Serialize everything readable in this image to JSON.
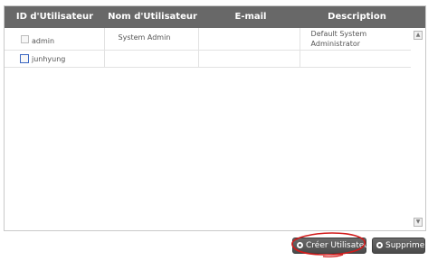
{
  "table": {
    "headers": [
      "ID d'Utilisateur",
      "Nom d'Utilisateur",
      "E-mail",
      "Description"
    ],
    "rows": [
      {
        "id": "admin",
        "name": "System Admin",
        "email": "",
        "description_line1": "Default System",
        "description_line2": "Administrator"
      },
      {
        "id": "junhyung",
        "name": "",
        "email": "",
        "description_line1": "",
        "description_line2": ""
      }
    ]
  },
  "actions": {
    "create_label": "Créer Utilisateur",
    "delete_label": "Supprimer"
  },
  "colors": {
    "header_bg": "#686868",
    "button_bg": "#4f4f4f",
    "annotation": "#d11a1a"
  },
  "icons": {
    "scroll_up": "scroll-up-arrow-icon",
    "scroll_down": "scroll-down-arrow-icon",
    "button_bullet": "circle-bullet-icon"
  }
}
